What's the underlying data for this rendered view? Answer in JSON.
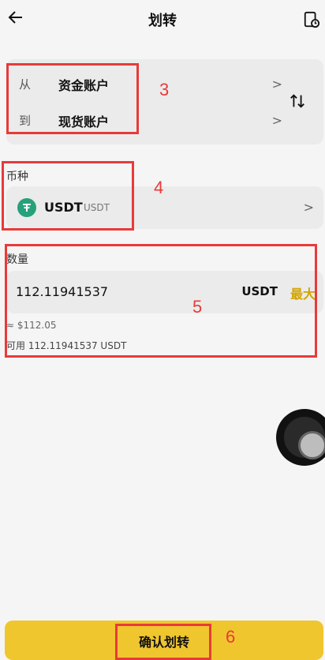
{
  "header": {
    "title": "划转",
    "back_icon": "arrow-left-icon",
    "history_icon": "document-clock-icon"
  },
  "accounts": {
    "from_key": "从",
    "from_value": "资金账户",
    "to_key": "到",
    "to_value": "现货账户",
    "chevron": ">",
    "swap_icon": "swap-vertical-icon"
  },
  "coin": {
    "label": "币种",
    "name": "USDT",
    "sub": "USDT",
    "chevron": ">"
  },
  "amount": {
    "label": "数量",
    "value": "112.11941537",
    "unit": "USDT",
    "max_label": "最大",
    "approx": "≈ $112.05",
    "available": "可用 112.11941537 USDT"
  },
  "confirm_label": "确认划转",
  "annotations": [
    "3",
    "4",
    "5",
    "6"
  ],
  "colors": {
    "accent": "#f0c62e",
    "max": "#d3a400",
    "annotation": "#e83a3a",
    "usdt": "#26a17b"
  }
}
